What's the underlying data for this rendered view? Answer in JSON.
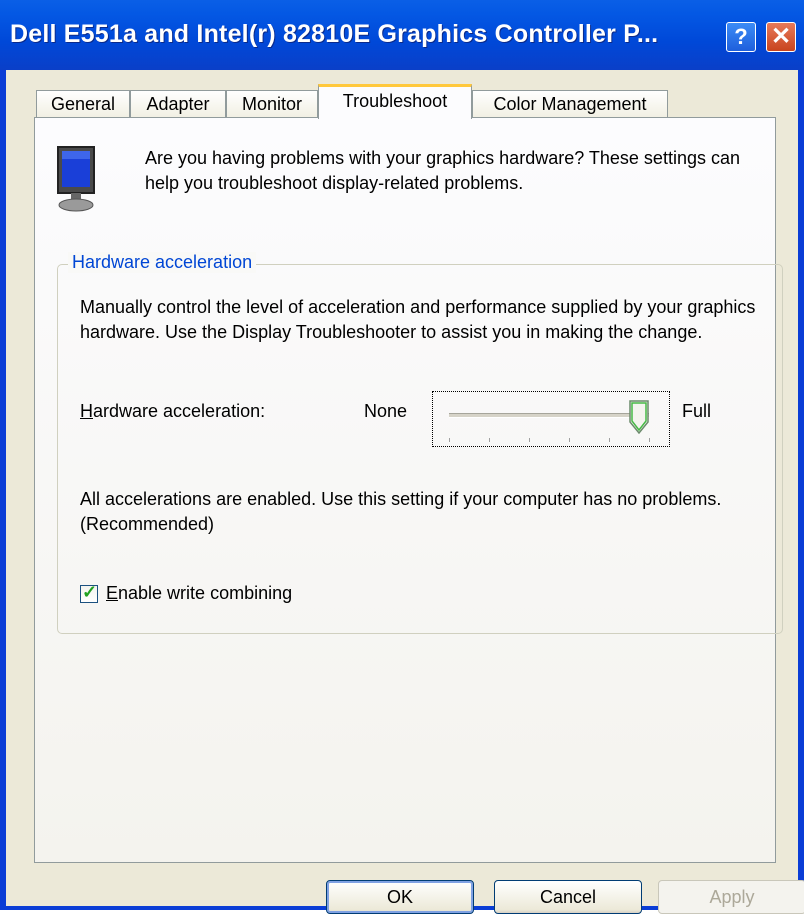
{
  "window": {
    "title": "Dell E551a and Intel(r) 82810E Graphics Controller P...",
    "help_label": "?",
    "close_label": "✕"
  },
  "tabs": [
    {
      "label": "General"
    },
    {
      "label": "Adapter"
    },
    {
      "label": "Monitor"
    },
    {
      "label": "Troubleshoot",
      "active": true
    },
    {
      "label": "Color Management"
    }
  ],
  "intro": "Are you having problems with your graphics hardware? These settings can help you troubleshoot display-related problems.",
  "group": {
    "legend": "Hardware acceleration",
    "description": "Manually control the level of acceleration and performance supplied by your graphics hardware. Use the Display Troubleshooter to assist you in making the change.",
    "slider_label_first": "H",
    "slider_label_rest": "ardware acceleration:",
    "min_label": "None",
    "max_label": "Full",
    "slider_level": 1.0,
    "status": "All accelerations are enabled. Use this setting if your computer has no problems. (Recommended)",
    "checkbox_label_first": "E",
    "checkbox_label_rest": "nable write combining",
    "checkbox_checked": true
  },
  "buttons": {
    "ok": "OK",
    "cancel": "Cancel",
    "apply": "Apply"
  },
  "colors": {
    "title_bar": "#0048d8",
    "accent": "#0046d5",
    "tab_highlight": "#ffc83c",
    "dialog_bg": "#ece9d8"
  }
}
